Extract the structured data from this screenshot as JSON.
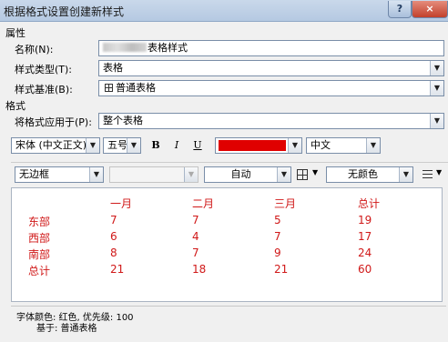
{
  "window": {
    "title": "根据格式设置创建新样式",
    "help": "?",
    "close": "×"
  },
  "properties": {
    "section": "属性",
    "name_label": "名称(N):",
    "name_value": "表格样式",
    "style_type_label": "样式类型(T):",
    "style_type_value": "表格",
    "based_on_label": "样式基准(B):",
    "based_on_value": "普通表格",
    "based_on_icon": "table-icon"
  },
  "format": {
    "section": "格式",
    "apply_to_label": "将格式应用于(P):",
    "apply_to_value": "整个表格",
    "font": "宋体 (中文正文)",
    "size": "五号",
    "bold": "B",
    "italic": "I",
    "underline": "U",
    "font_color": "#e00000",
    "language": "中文"
  },
  "borders": {
    "border_style": "无边框",
    "border_width": "",
    "border_color": "自动",
    "border_icon": "borders-grid-icon",
    "shading": "无颜色",
    "align_icon": "cell-alignment-icon"
  },
  "preview": {
    "headers": [
      "一月",
      "二月",
      "三月",
      "总计"
    ],
    "rows": [
      {
        "label": "东部",
        "values": [
          "7",
          "7",
          "5",
          "19"
        ]
      },
      {
        "label": "西部",
        "values": [
          "6",
          "4",
          "7",
          "17"
        ]
      },
      {
        "label": "南部",
        "values": [
          "8",
          "7",
          "9",
          "24"
        ]
      },
      {
        "label": "总计",
        "values": [
          "21",
          "18",
          "21",
          "60"
        ]
      }
    ]
  },
  "description": {
    "line1": "字体颜色: 红色, 优先级: 100",
    "line2": "基于: 普通表格"
  }
}
